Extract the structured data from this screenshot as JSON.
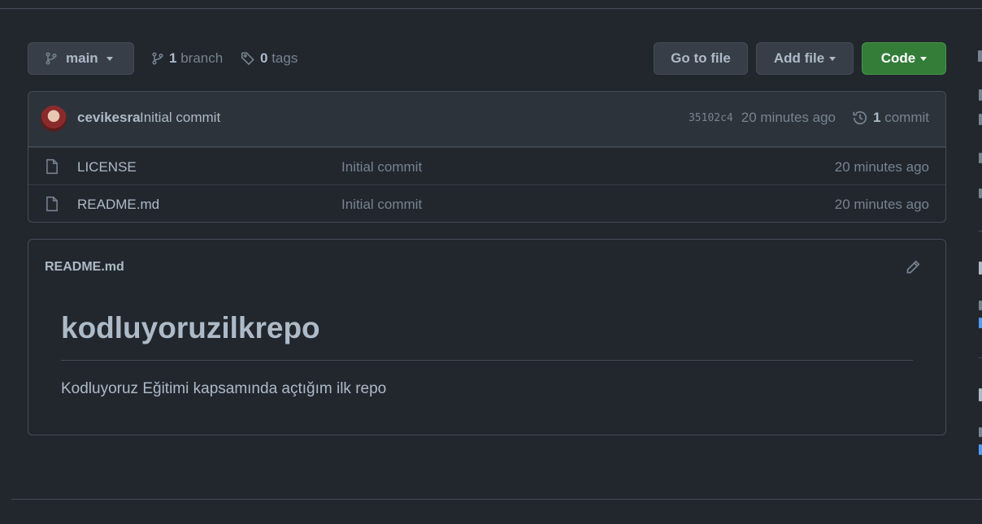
{
  "toolbar": {
    "branch_name": "main",
    "branch_count": "1",
    "branch_label": "branch",
    "tag_count": "0",
    "tag_label": "tags",
    "go_to_file": "Go to file",
    "add_file": "Add file",
    "code": "Code"
  },
  "latest_commit": {
    "author": "cevikesra",
    "message": "Initial commit",
    "sha": "35102c4",
    "age": "20 minutes ago",
    "commit_count": "1",
    "commit_label": "commit"
  },
  "files": [
    {
      "name": "LICENSE",
      "commit": "Initial commit",
      "age": "20 minutes ago"
    },
    {
      "name": "README.md",
      "commit": "Initial commit",
      "age": "20 minutes ago"
    }
  ],
  "readme": {
    "filename": "README.md",
    "heading": "kodluyoruzilkrepo",
    "body": "Kodluyoruz Eğitimi kapsamında açtığım ilk repo"
  },
  "icons": {
    "branch": "git-branch-icon",
    "tag": "tag-icon",
    "history": "history-icon",
    "file": "file-icon",
    "edit": "pencil-icon"
  },
  "colors": {
    "background": "#22272e",
    "header": "#2d333b",
    "border": "#444c56",
    "text": "#adbac7",
    "muted": "#768390",
    "primary_button": "#347d39",
    "link": "#539bf5"
  }
}
